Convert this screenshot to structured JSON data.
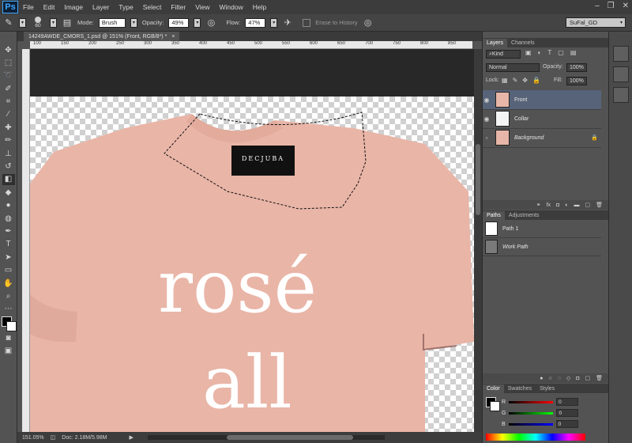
{
  "app": {
    "logo": "Ps"
  },
  "menu": [
    "File",
    "Edit",
    "Image",
    "Layer",
    "Type",
    "Select",
    "Filter",
    "View",
    "Window",
    "Help"
  ],
  "window_controls": [
    "–",
    "❐",
    "✕"
  ],
  "options": {
    "brush_size": "60",
    "mode_label": "Mode:",
    "mode_value": "Brush",
    "opacity_label": "Opacity:",
    "opacity_value": "49%",
    "flow_label": "Flow:",
    "flow_value": "47%",
    "erase_history": "Erase to History",
    "workspace": "SuFal_GD"
  },
  "document": {
    "tab_title": "14249AWDE_CMORS_1.psd @ 151% (Front, RGB/8*) *",
    "close": "×",
    "ruler_ticks": [
      "100",
      "150",
      "200",
      "250",
      "300",
      "350",
      "400",
      "450",
      "500",
      "550",
      "600",
      "650",
      "700",
      "750",
      "800",
      "850"
    ]
  },
  "shirt": {
    "label_brand": "DECJUBA",
    "text_line1": "rosé",
    "text_line2": "all"
  },
  "status": {
    "zoom": "151.05%",
    "doc": "Doc: 2.18M/5.98M"
  },
  "layers_panel": {
    "tabs": [
      "Layers",
      "Channels"
    ],
    "filter": "Kind",
    "blend_mode": "Normal",
    "opacity_label": "Opacity:",
    "opacity_value": "100%",
    "lock_label": "Lock:",
    "fill_label": "Fill:",
    "fill_value": "100%",
    "layers": [
      {
        "name": "Front",
        "selected": true,
        "visible": true
      },
      {
        "name": "Collar",
        "selected": false,
        "visible": true
      },
      {
        "name": "Background",
        "selected": false,
        "visible": false,
        "locked": true
      }
    ]
  },
  "paths_panel": {
    "tabs": [
      "Paths",
      "Adjustments"
    ],
    "paths": [
      {
        "name": "Path 1"
      },
      {
        "name": "Work Path"
      }
    ]
  },
  "color_panel": {
    "tabs": [
      "Color",
      "Swatches",
      "Styles"
    ],
    "channels": [
      {
        "label": "R",
        "value": "0",
        "color": "#ff3030"
      },
      {
        "label": "G",
        "value": "0",
        "color": "#30c030"
      },
      {
        "label": "B",
        "value": "0",
        "color": "#3050ff"
      }
    ]
  },
  "colors": {
    "shirt": "#e9b5a7",
    "selection": "#576378",
    "ps_blue": "#3da7ff"
  }
}
